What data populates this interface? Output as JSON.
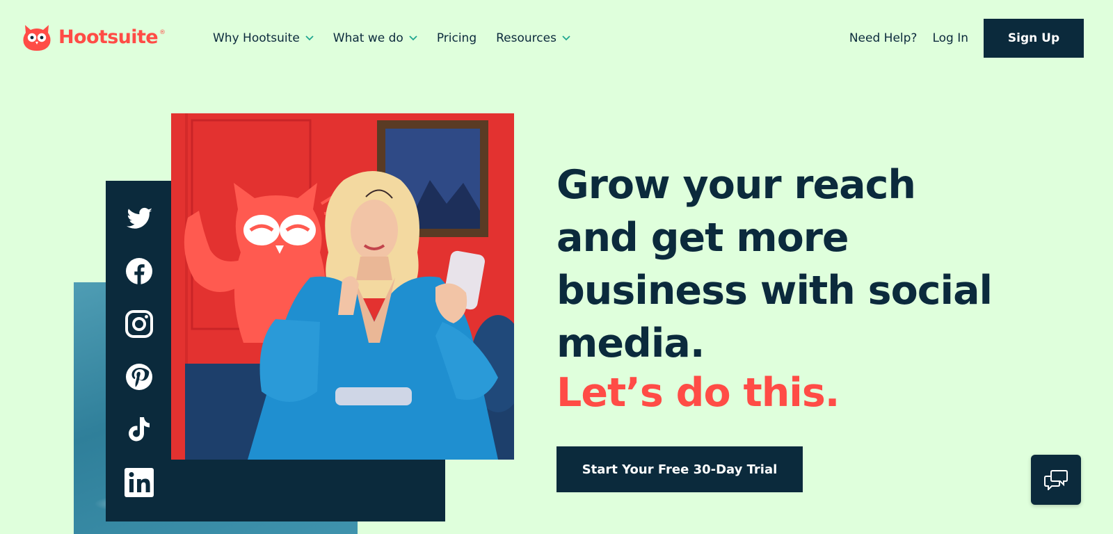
{
  "header": {
    "logo_text": "Hootsuite",
    "logo_reg": "®",
    "nav": [
      {
        "label": "Why Hootsuite",
        "has_dropdown": true
      },
      {
        "label": "What we do",
        "has_dropdown": true
      },
      {
        "label": "Pricing",
        "has_dropdown": false
      },
      {
        "label": "Resources",
        "has_dropdown": true
      }
    ],
    "help_label": "Need Help?",
    "login_label": "Log In",
    "signup_label": "Sign Up"
  },
  "hero": {
    "headline": "Grow your reach and get more business with social media.",
    "tagline": "Let’s do this.",
    "cta_label": "Start Your Free 30-Day Trial",
    "social_icons": [
      "twitter-icon",
      "facebook-icon",
      "instagram-icon",
      "pinterest-icon",
      "tiktok-icon",
      "linkedin-icon"
    ]
  },
  "chat": {
    "icon": "chat-bubbles-icon"
  },
  "colors": {
    "background": "#dfffdc",
    "navy": "#0b2a3c",
    "coral": "#ff4c46",
    "photo_red": "#e8302f",
    "dress_blue": "#1f8fd0"
  }
}
